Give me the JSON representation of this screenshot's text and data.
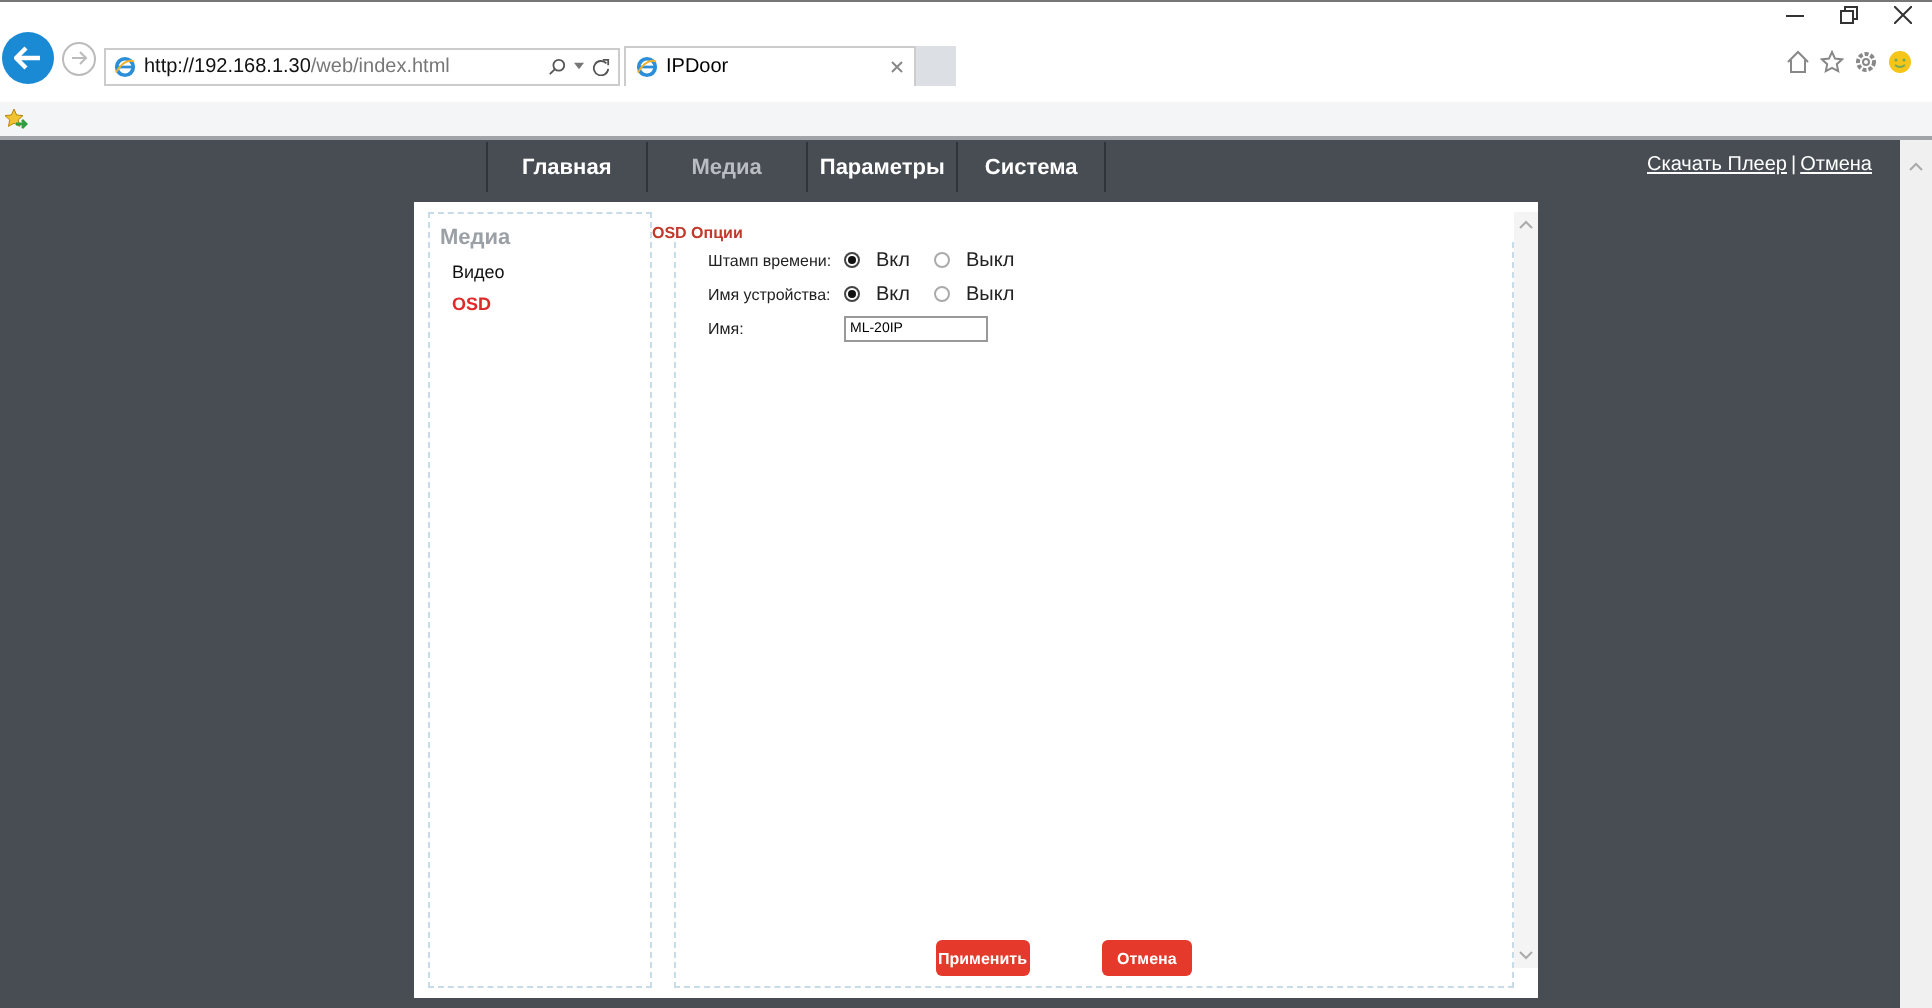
{
  "browser": {
    "url_host": "http://192.168.1.30",
    "url_path": "/web/index.html",
    "tab_title": "IPDoor"
  },
  "nav": [
    {
      "label": "Главная",
      "selected": false
    },
    {
      "label": "Медиа",
      "selected": true
    },
    {
      "label": "Параметры",
      "selected": false
    },
    {
      "label": "Система",
      "selected": false
    }
  ],
  "top_links": [
    "Скачать Плеер",
    "|",
    "Отмена"
  ],
  "sidebar": {
    "title": "Медиа",
    "items": [
      {
        "label": "Видео",
        "selected": false
      },
      {
        "label": "OSD",
        "selected": true
      }
    ]
  },
  "section_title": "OSD Опции",
  "settings": [
    {
      "kind": "radio",
      "label": "Штамп времени:",
      "options": [
        {
          "label": "Вкл",
          "selected": true
        },
        {
          "label": "Выкл",
          "selected": false
        }
      ]
    },
    {
      "kind": "radio",
      "label": "Имя устройства:",
      "options": [
        {
          "label": "Вкл",
          "selected": true
        },
        {
          "label": "Выкл",
          "selected": false
        }
      ]
    },
    {
      "kind": "text",
      "label": "Имя:",
      "value": "ML-20IP"
    }
  ],
  "buttons": [
    "Применить",
    "Отмена"
  ]
}
